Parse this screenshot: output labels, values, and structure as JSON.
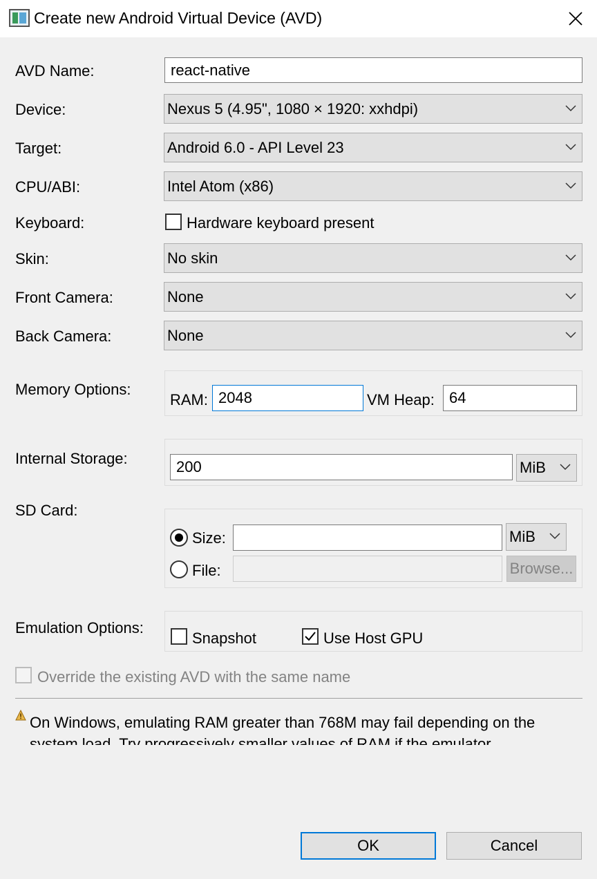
{
  "window": {
    "title": "Create new Android Virtual Device (AVD)"
  },
  "form": {
    "avd_name": {
      "label": "AVD Name:",
      "value": "react-native"
    },
    "device": {
      "label": "Device:",
      "value": "Nexus 5 (4.95\", 1080 × 1920: xxhdpi)"
    },
    "target": {
      "label": "Target:",
      "value": "Android 6.0 - API Level 23"
    },
    "cpu_abi": {
      "label": "CPU/ABI:",
      "value": "Intel Atom (x86)"
    },
    "keyboard": {
      "label": "Keyboard:",
      "checkbox_label": "Hardware keyboard present",
      "checked": false
    },
    "skin": {
      "label": "Skin:",
      "value": "No skin"
    },
    "front_camera": {
      "label": "Front Camera:",
      "value": "None"
    },
    "back_camera": {
      "label": "Back Camera:",
      "value": "None"
    },
    "memory": {
      "label": "Memory Options:",
      "ram_label": "RAM:",
      "ram_value": "2048",
      "vm_heap_label": "VM Heap:",
      "vm_heap_value": "64"
    },
    "internal_storage": {
      "label": "Internal Storage:",
      "value": "200",
      "unit": "MiB"
    },
    "sd_card": {
      "label": "SD Card:",
      "size_label": "Size:",
      "size_value": "",
      "size_unit": "MiB",
      "size_selected": true,
      "file_label": "File:",
      "file_value": "",
      "browse_label": "Browse..."
    },
    "emulation": {
      "label": "Emulation Options:",
      "snapshot_label": "Snapshot",
      "snapshot_checked": false,
      "host_gpu_label": "Use Host GPU",
      "host_gpu_checked": true
    },
    "override": {
      "label": "Override the existing AVD with the same name",
      "checked": false
    }
  },
  "warning": {
    "icon": "warning-icon",
    "text": "On Windows, emulating RAM greater than 768M may fail depending on the system load. Try progressively smaller values of RAM if the emulator"
  },
  "buttons": {
    "ok": "OK",
    "cancel": "Cancel"
  },
  "colors": {
    "focus_border": "#0078d7",
    "dialog_bg": "#f0f0f0",
    "combo_bg": "#e1e1e1"
  }
}
